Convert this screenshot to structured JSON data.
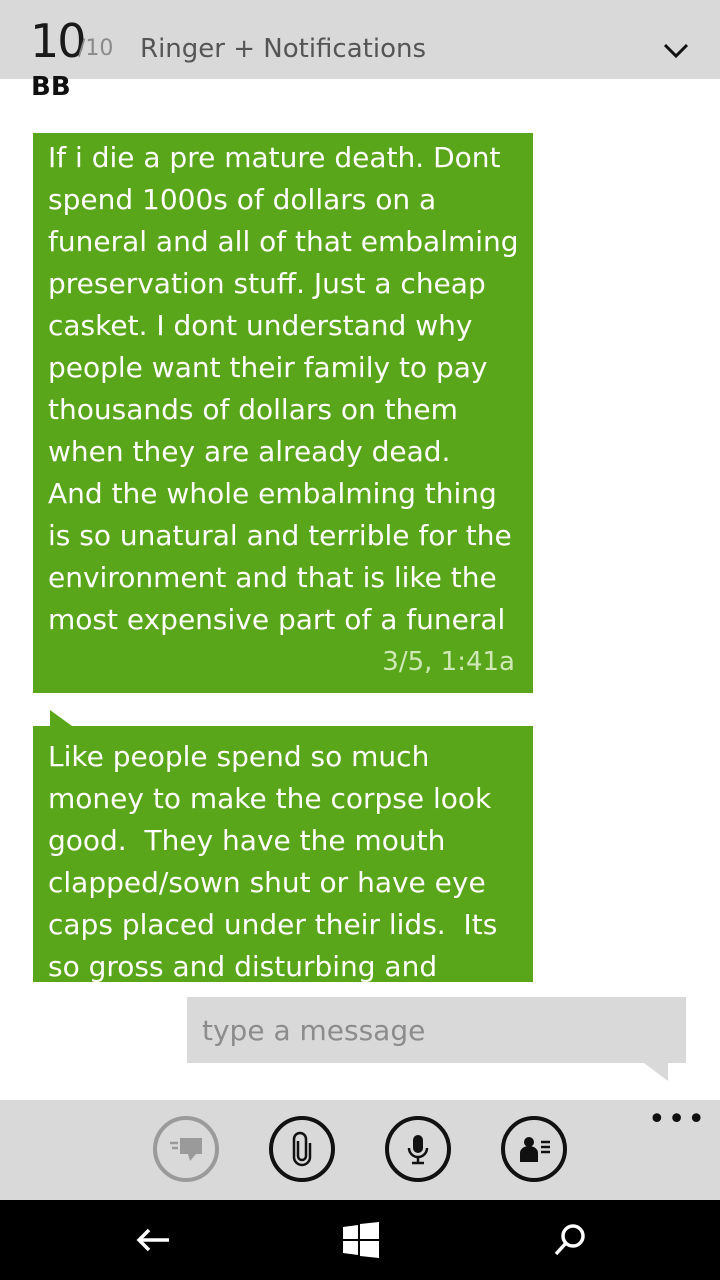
{
  "volume": {
    "level": "10",
    "max": "/10",
    "label": "Ringer + Notifications",
    "icon": "chevron-down-icon"
  },
  "contact": {
    "name": "BB"
  },
  "messages": [
    {
      "text": "If i die a pre mature death. Dont spend 1000s of dollars on a funeral and all of that embalming preservation stuff. Just a cheap casket. I dont understand why people want their family to pay thousands of dollars on them when they are already dead.\nAnd the whole embalming thing is so unatural and terrible for the environment and that is like the most expensive part of a funeral",
      "time": "3/5, 1:41a"
    },
    {
      "text": "Like people spend so much money to make the corpse look good.  They have the mouth clapped/sown shut or have eye caps placed under their lids.  Its so gross and disturbing and"
    }
  ],
  "compose": {
    "placeholder": "type a message"
  },
  "app_bar": {
    "buttons": [
      "switch-conversation-icon",
      "attach-icon",
      "microphone-icon",
      "contact-card-icon"
    ],
    "more": "•••"
  },
  "nav": {
    "icons": [
      "back-arrow-icon",
      "windows-start-icon",
      "search-icon"
    ]
  },
  "colors": {
    "bubble": "#5aa61a",
    "bar": "#d9d9d9",
    "nav": "#000000"
  }
}
